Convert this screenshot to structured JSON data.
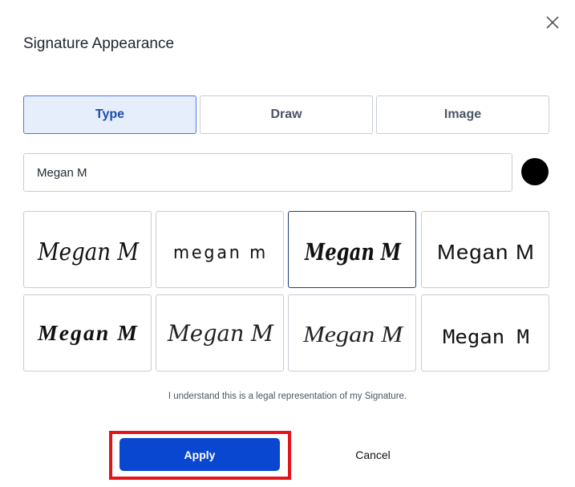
{
  "dialog": {
    "title": "Signature Appearance",
    "close_icon": "close-icon"
  },
  "tabs": [
    {
      "label": "Type",
      "active": true
    },
    {
      "label": "Draw",
      "active": false
    },
    {
      "label": "Image",
      "active": false
    }
  ],
  "name_input": {
    "value": "Megan M"
  },
  "ink_color": "#000000",
  "signatures": [
    {
      "text": "Megan M",
      "style": "script-flourish",
      "selected": false
    },
    {
      "text": "megan m",
      "style": "round-hand",
      "selected": false
    },
    {
      "text": "Megan M",
      "style": "bold-brush",
      "selected": true
    },
    {
      "text": "Megan M",
      "style": "marker-print",
      "selected": false
    },
    {
      "text": "Megan M",
      "style": "bold-italic-hand",
      "selected": false
    },
    {
      "text": "Megan M",
      "style": "thin-script",
      "selected": false
    },
    {
      "text": "Megan M",
      "style": "light-calligraphy",
      "selected": false
    },
    {
      "text": "Megan M",
      "style": "narrow-print",
      "selected": false
    }
  ],
  "legal_text": "I understand this is a legal representation of my Signature.",
  "buttons": {
    "apply": "Apply",
    "cancel": "Cancel"
  }
}
